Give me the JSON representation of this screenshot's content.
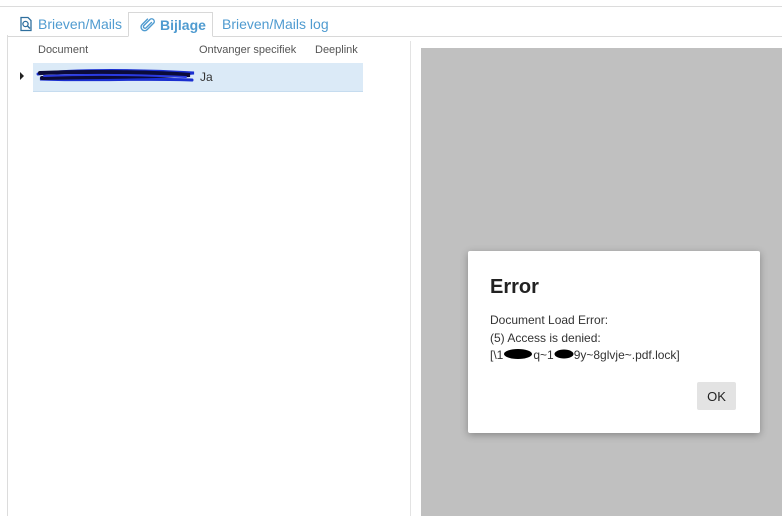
{
  "tabs": {
    "mails": {
      "label": "Brieven/Mails",
      "icon": "document-search-icon"
    },
    "bijlage": {
      "label": "Bijlage",
      "icon": "paperclip-icon",
      "active": true
    },
    "log": {
      "label": "Brieven/Mails log"
    }
  },
  "grid": {
    "columns": {
      "document": "Document",
      "ontvanger": "Ontvanger specifiek",
      "deeplink": "Deeplink"
    },
    "rows": [
      {
        "document_redacted": true,
        "ontvanger": "Ja",
        "deeplink": ""
      }
    ]
  },
  "dialog": {
    "title": "Error",
    "line1": "Document Load Error:",
    "line2": "(5) Access is denied:",
    "line3_part1": "[\\1",
    "line3_part2": "q~1",
    "line3_part3": "9y~8glvje~.pdf.lock]",
    "ok_label": "OK"
  },
  "colors": {
    "accent": "#4f9bd0",
    "selected_row": "#dbeaf7",
    "viewer_bg": "#c0c0c0",
    "redaction": "#000000",
    "redaction_scribble": "#1a2fd0"
  }
}
